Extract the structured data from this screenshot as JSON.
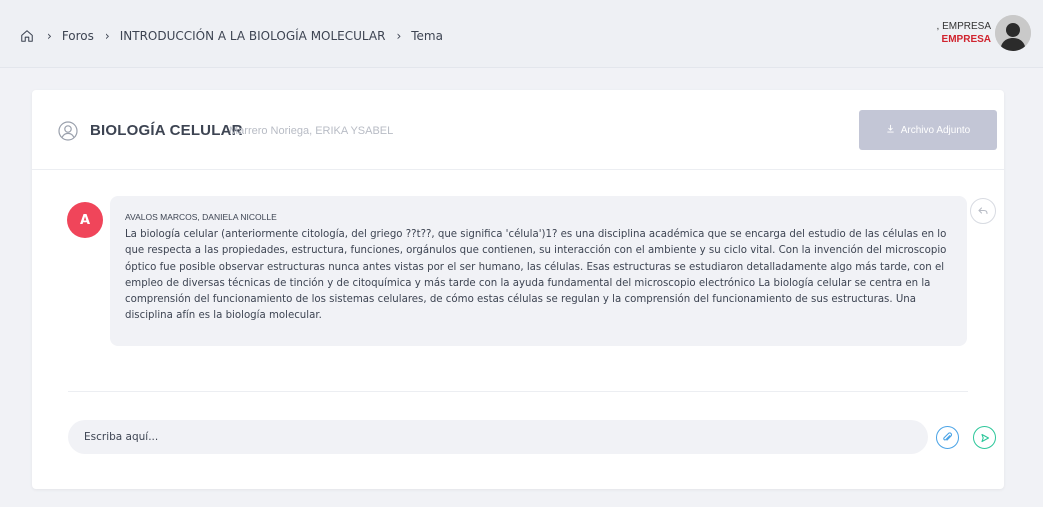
{
  "breadcrumb": {
    "home_icon": "home-icon",
    "separator": "›",
    "items": [
      "Foros",
      "INTRODUCCIÓN A LA BIOLOGÍA MOLECULAR",
      "Tema"
    ]
  },
  "user": {
    "name_line1": ", EMPRESA",
    "name_line2": "EMPRESA",
    "avatar_icon": "user-avatar"
  },
  "topic": {
    "icon": "user-circle-icon",
    "title": "BIOLOGÍA CELULAR",
    "author": "Marrero Noriega, ERIKA YSABEL",
    "attach_label": "Archivo Adjunto",
    "attach_icon": "download-icon"
  },
  "message": {
    "avatar_letter": "A",
    "author": "AVALOS MARCOS, DANIELA NICOLLE",
    "body": "La biología celular (anteriormente citología, del griego ??t??, que significa 'célula')1? es una disciplina académica que se encarga del estudio de las células en lo que respecta a las propiedades, estructura, funciones, orgánulos que contienen, su interacción con el ambiente y su ciclo vital. Con la invención del microscopio óptico fue posible observar estructuras nunca antes vistas por el ser humano, las células. Esas estructuras se estudiaron detalladamente algo más tarde, con el empleo de diversas técnicas de tinción y de citoquímica y más tarde con la ayuda fundamental del microscopio electrónico La biología celular se centra en la comprensión del funcionamiento de los sistemas celulares, de cómo estas células se regulan y la comprensión del funcionamiento de sus estructuras. Una disciplina afín es la biología molecular.",
    "reply_icon": "reply-icon"
  },
  "composer": {
    "placeholder": "Escriba aquí...",
    "attach_icon": "paperclip-icon",
    "send_icon": "send-icon"
  },
  "colors": {
    "accent_red": "#f0455a",
    "brand_red": "#d0232e",
    "attach_button": "#c3c6d6",
    "clip_blue": "#4aa3e6",
    "send_green": "#2cc79a"
  }
}
